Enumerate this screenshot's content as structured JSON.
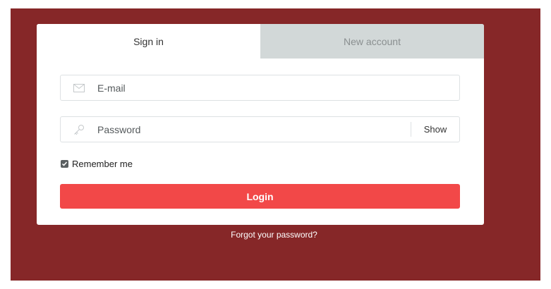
{
  "tabs": {
    "sign_in": "Sign in",
    "new_account": "New account"
  },
  "form": {
    "email_placeholder": "E-mail",
    "password_placeholder": "Password",
    "show_label": "Show",
    "remember_label": "Remember me",
    "remember_checked": true,
    "login_label": "Login"
  },
  "footer": {
    "forgot_label": "Forgot your password?"
  },
  "icons": {
    "email": "mail-icon",
    "password": "key-icon",
    "checkbox": "check-icon"
  },
  "colors": {
    "background": "#862728",
    "login_button": "#f24848",
    "inactive_tab": "#d2d8d8"
  }
}
